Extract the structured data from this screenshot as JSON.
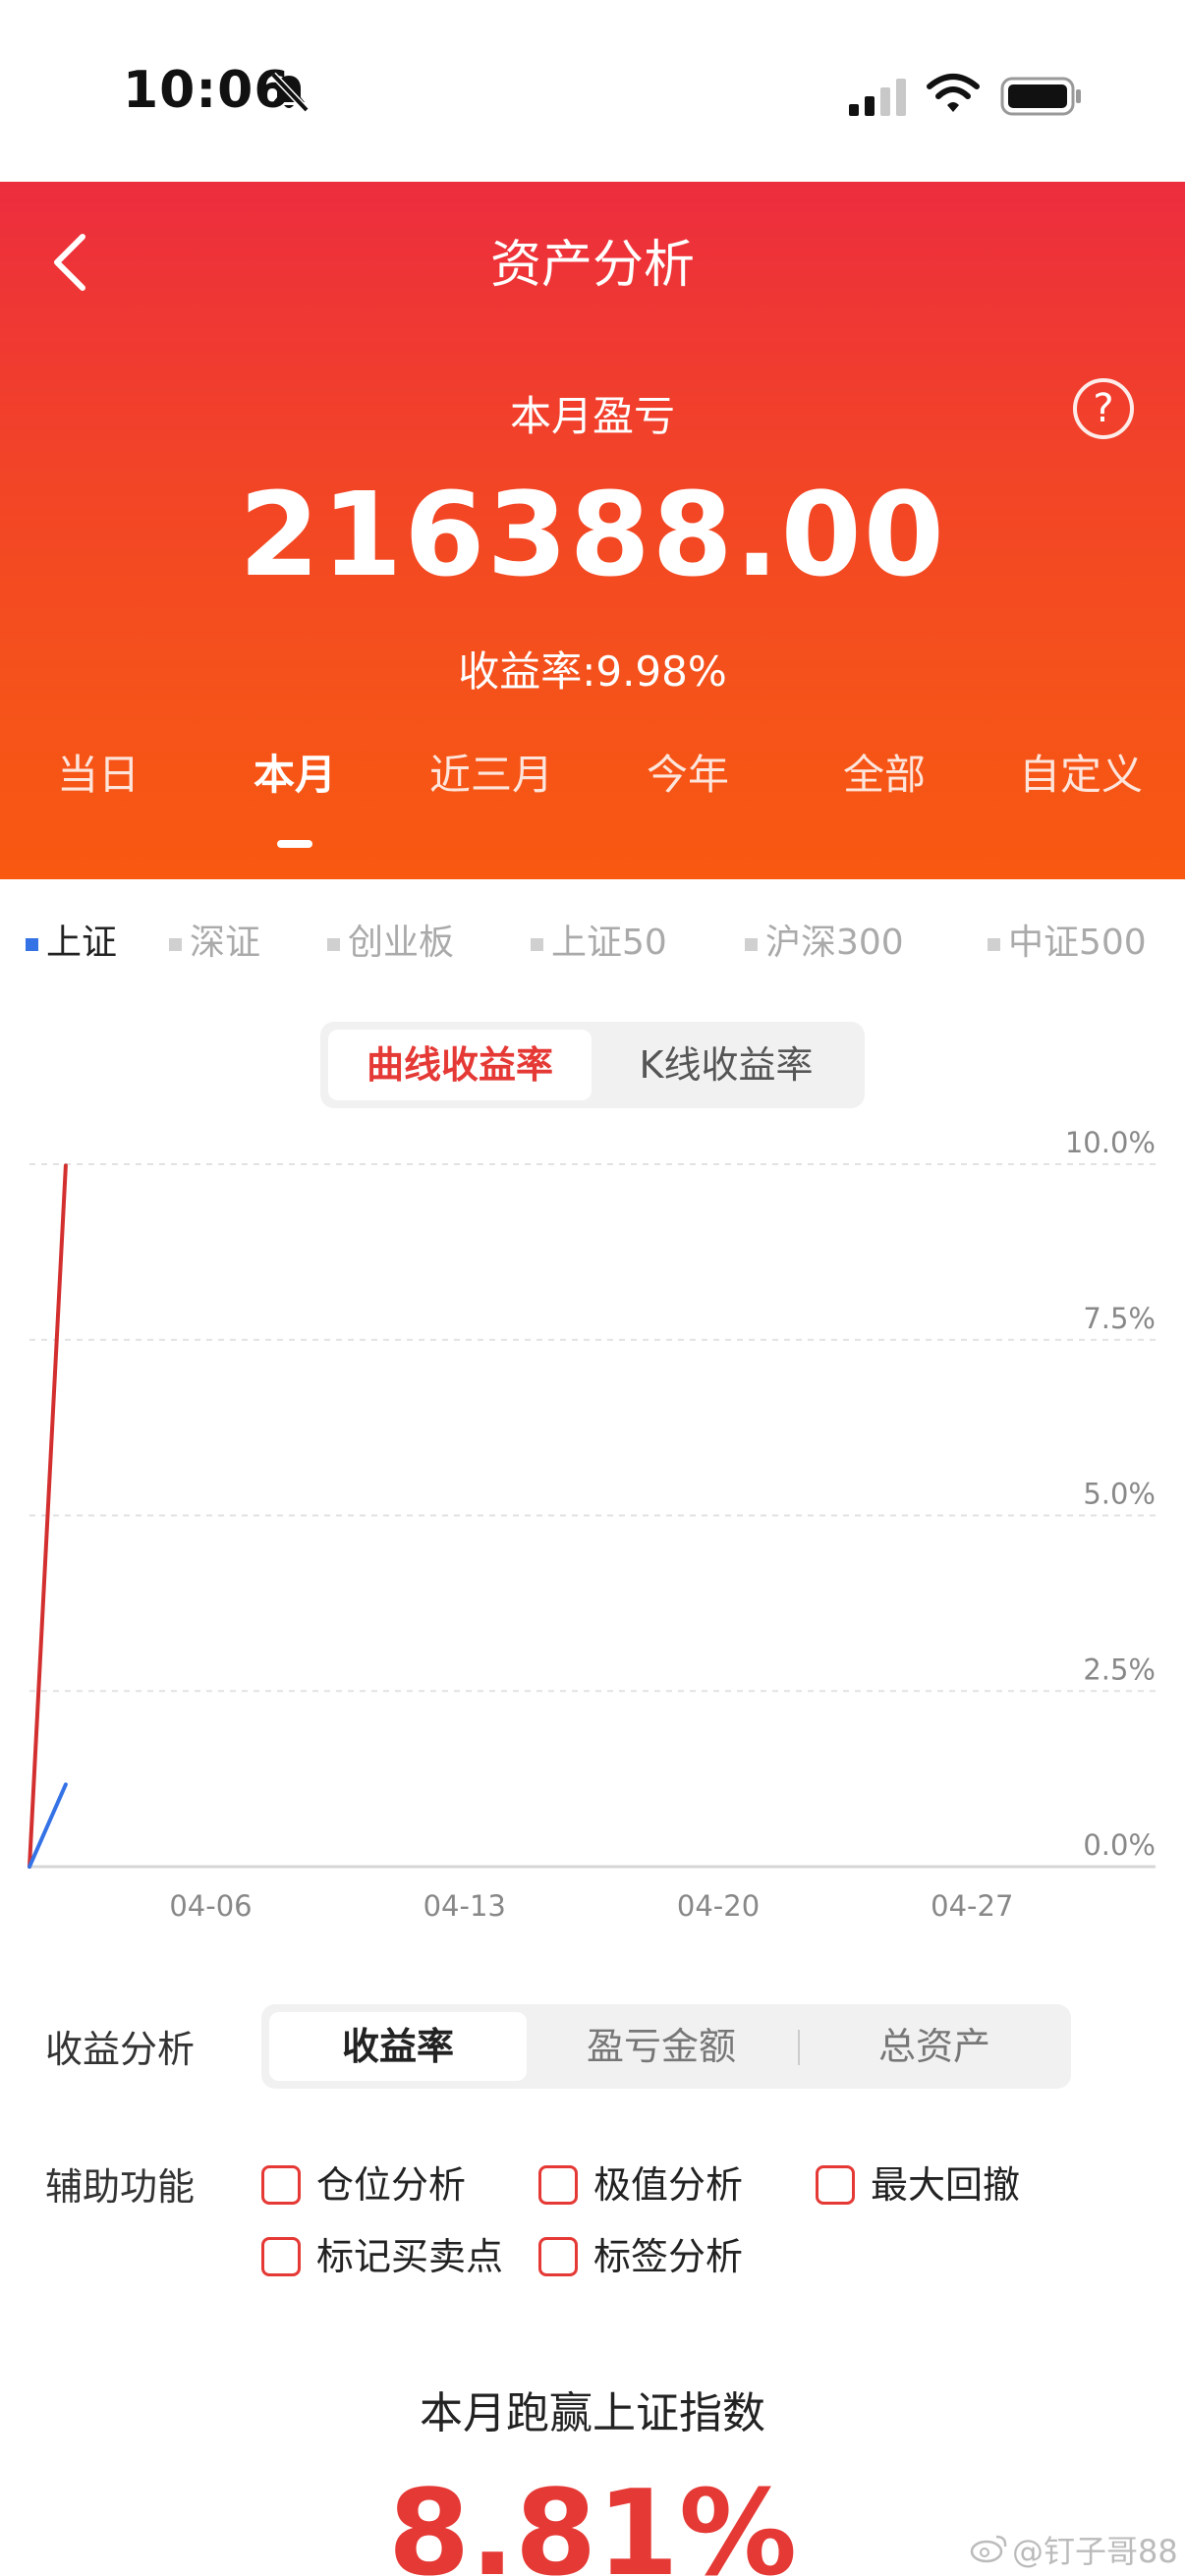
{
  "status_bar": {
    "time": "10:06"
  },
  "header": {
    "title": "资产分析",
    "pl_label": "本月盈亏",
    "pl_value": "216388.00",
    "yield_text": "收益率:9.98%",
    "help_glyph": "?"
  },
  "period_tabs": [
    {
      "label": "当日"
    },
    {
      "label": "本月"
    },
    {
      "label": "近三月"
    },
    {
      "label": "今年"
    },
    {
      "label": "全部"
    },
    {
      "label": "自定义"
    }
  ],
  "index_tabs": [
    {
      "label": "上证"
    },
    {
      "label": "深证"
    },
    {
      "label": "创业板"
    },
    {
      "label": "上证50"
    },
    {
      "label": "沪深300"
    },
    {
      "label": "中证500"
    }
  ],
  "chart_mode": {
    "curve": "曲线收益率",
    "kline": "K线收益率"
  },
  "chart_data": {
    "type": "line",
    "x_ticks": [
      "04-06",
      "04-13",
      "04-20",
      "04-27"
    ],
    "y_ticks": [
      "10.0%",
      "7.5%",
      "5.0%",
      "2.5%",
      "0.0%"
    ],
    "ylim": [
      0,
      10
    ],
    "series": [
      {
        "color": "#d32f2f",
        "points": [
          [
            "04-01",
            0.0
          ],
          [
            "04-02",
            9.98
          ]
        ]
      },
      {
        "color": "#3572e6",
        "points": [
          [
            "04-01",
            0.0
          ],
          [
            "04-02",
            1.17
          ]
        ]
      }
    ]
  },
  "analysis": {
    "label": "收益分析",
    "options": [
      "收益率",
      "盈亏金额",
      "总资产"
    ]
  },
  "aux": {
    "label": "辅助功能",
    "options": [
      "仓位分析",
      "极值分析",
      "最大回撤",
      "标记买卖点",
      "标签分析"
    ]
  },
  "beat": {
    "label": "本月跑赢上证指数",
    "value": "8.81%"
  },
  "watermark": "@钉子哥88",
  "colors": {
    "accent": "#e53935",
    "header_top": "#ec2d3e",
    "header_bottom": "#f85810",
    "index_active": "#3572e6"
  }
}
